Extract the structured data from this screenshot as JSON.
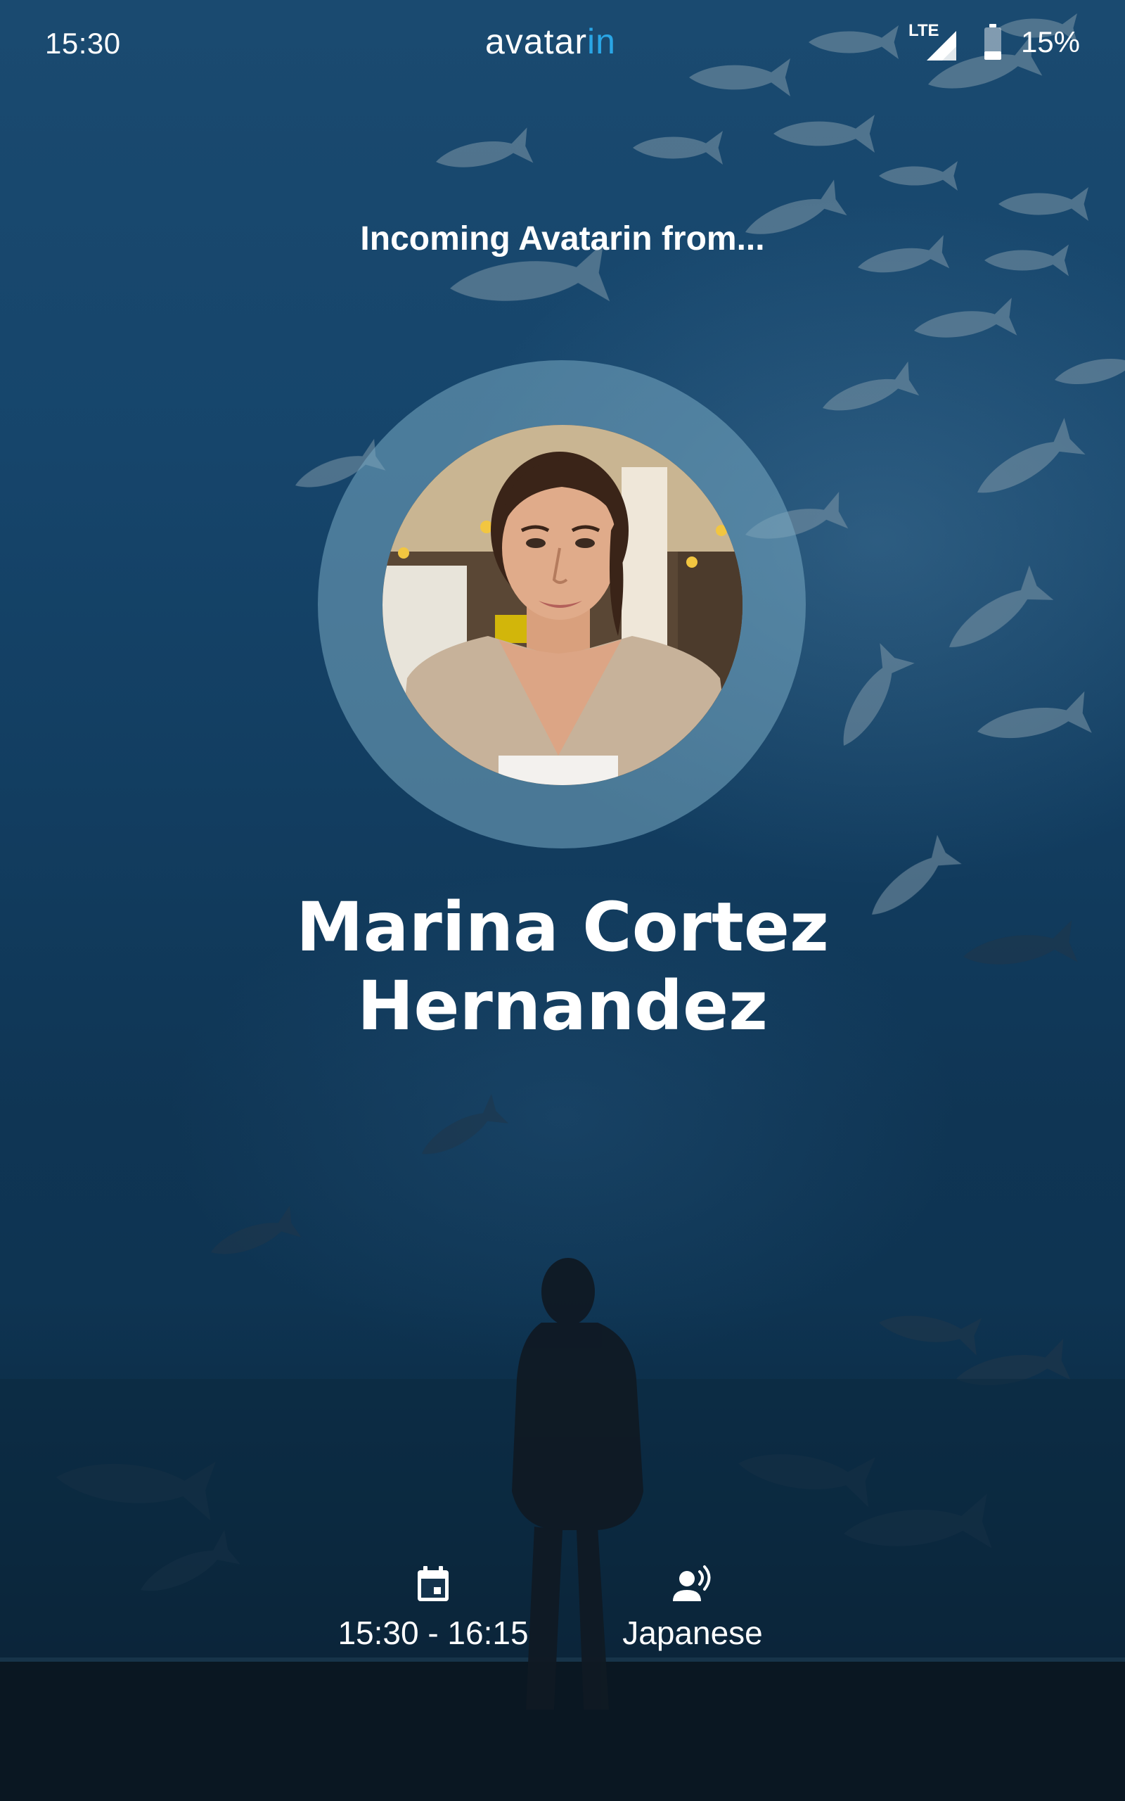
{
  "status_bar": {
    "time": "15:30",
    "network": "LTE",
    "battery": "15%"
  },
  "brand": {
    "name_prefix": "avatar",
    "name_suffix": "in",
    "accent_color": "#2aa6e6"
  },
  "call": {
    "heading": "Incoming Avatarin from...",
    "caller_first_line": "Marina Cortez",
    "caller_second_line": "Hernandez"
  },
  "info": {
    "schedule": {
      "icon": "calendar-icon",
      "label": "15:30 - 16:15"
    },
    "language": {
      "icon": "voice-person-icon",
      "label": "Japanese"
    }
  },
  "colors": {
    "background": "#123d60",
    "text": "#ffffff",
    "avatar_ring": "#78aac3"
  }
}
